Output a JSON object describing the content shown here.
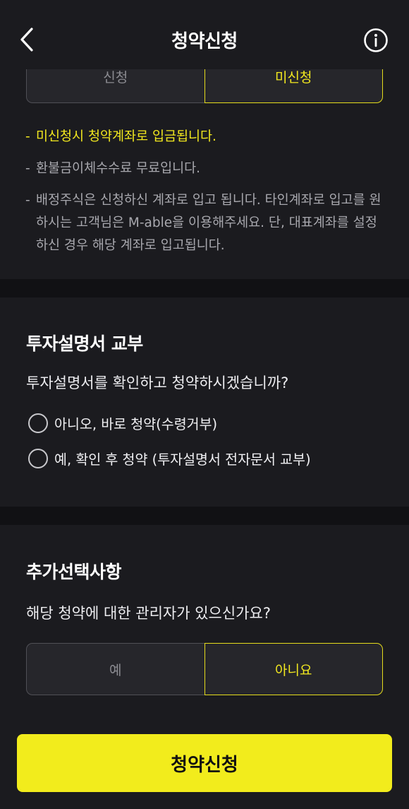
{
  "header": {
    "title": "청약신청",
    "back_icon": "chevron-left-icon",
    "info_icon": "info-circle-icon"
  },
  "apply_toggle": {
    "options": [
      "신청",
      "미신청"
    ],
    "selected": "미신청"
  },
  "notes": [
    "미신청시 청약계좌로 입금됩니다.",
    "환불금이체수수료 무료입니다.",
    "배정주식은 신청하신 계좌로 입고 됩니다. 타인계좌로 입고를 원하시는 고객님은 M-able을 이용해주세요. 단, 대표계좌를 설정하신 경우 해당 계좌로 입고됩니다."
  ],
  "note_dash": "-",
  "prospectus": {
    "title": "투자설명서 교부",
    "question": "투자설명서를 확인하고 청약하시겠습니까?",
    "options": [
      "아니오, 바로 청약(수령거부)",
      "예, 확인 후 청약 (투자설명서 전자문서 교부)"
    ]
  },
  "additional": {
    "title": "추가선택사항",
    "question": "해당 청약에 대한 관리자가 있으신가요?",
    "options": [
      "예",
      "아니요"
    ],
    "selected": "아니요"
  },
  "submit_label": "청약신청",
  "colors": {
    "background": "#1b1b1f",
    "accent": "#f2e81f",
    "divider": "#111114"
  }
}
